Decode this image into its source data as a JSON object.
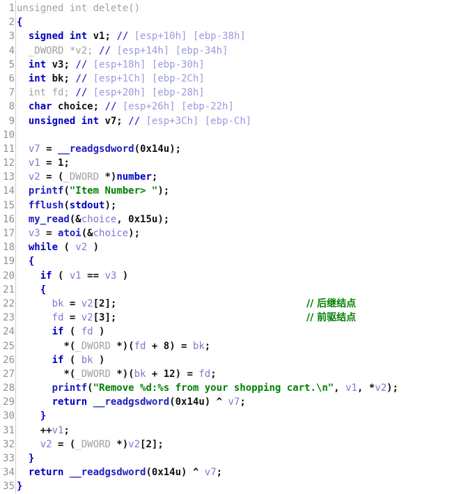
{
  "view": {
    "name": "hexrays-pseudocode",
    "function_name": "delete",
    "first_line": 1,
    "last_line": 35,
    "total_lines": 35
  },
  "colors": {
    "background": "#ffffff",
    "line_number": "#909090",
    "greyed_text": "#a0a0a0",
    "keyword": "#0000c0",
    "local_variable": "#7a7ad0",
    "global_variable": "#0000c0",
    "function_name": "#2020c0",
    "string_literal": "#008000",
    "comment": "#008000",
    "stack_comment": "#9a9ae0",
    "gutter_rule": "#d0d0d0"
  },
  "side_comments": [
    {
      "line": 22,
      "text": "// 后继结点"
    },
    {
      "line": 23,
      "text": "// 前驱结点"
    }
  ],
  "lines": [
    {
      "n": "1",
      "tokens": [
        {
          "t": "gray",
          "v": "unsigned int delete()"
        }
      ]
    },
    {
      "n": "2",
      "tokens": [
        {
          "t": "brace",
          "v": "{"
        }
      ]
    },
    {
      "n": "3",
      "tokens": [
        {
          "t": "plain",
          "v": "  "
        },
        {
          "t": "kw",
          "v": "signed int"
        },
        {
          "t": "plain",
          "v": " v1; "
        },
        {
          "t": "slash",
          "v": "// "
        },
        {
          "t": "stk",
          "v": "[esp+10h] [ebp-38h]"
        }
      ]
    },
    {
      "n": "4",
      "tokens": [
        {
          "t": "plain",
          "v": "  "
        },
        {
          "t": "gray",
          "v": "_DWORD *v2; "
        },
        {
          "t": "slash",
          "v": "// "
        },
        {
          "t": "stk",
          "v": "[esp+14h] [ebp-34h]"
        }
      ]
    },
    {
      "n": "5",
      "tokens": [
        {
          "t": "plain",
          "v": "  "
        },
        {
          "t": "kw",
          "v": "int"
        },
        {
          "t": "plain",
          "v": " v3; "
        },
        {
          "t": "slash",
          "v": "// "
        },
        {
          "t": "stk",
          "v": "[esp+18h] [ebp-30h]"
        }
      ]
    },
    {
      "n": "6",
      "tokens": [
        {
          "t": "plain",
          "v": "  "
        },
        {
          "t": "kw",
          "v": "int"
        },
        {
          "t": "plain",
          "v": " bk; "
        },
        {
          "t": "slash",
          "v": "// "
        },
        {
          "t": "stk",
          "v": "[esp+1Ch] [ebp-2Ch]"
        }
      ]
    },
    {
      "n": "7",
      "tokens": [
        {
          "t": "plain",
          "v": "  "
        },
        {
          "t": "gray",
          "v": "int fd; "
        },
        {
          "t": "slash",
          "v": "// "
        },
        {
          "t": "stk",
          "v": "[esp+20h] [ebp-28h]"
        }
      ]
    },
    {
      "n": "8",
      "tokens": [
        {
          "t": "plain",
          "v": "  "
        },
        {
          "t": "kw",
          "v": "char"
        },
        {
          "t": "plain",
          "v": " choice; "
        },
        {
          "t": "slash",
          "v": "// "
        },
        {
          "t": "stk",
          "v": "[esp+26h] [ebp-22h]"
        }
      ]
    },
    {
      "n": "9",
      "tokens": [
        {
          "t": "plain",
          "v": "  "
        },
        {
          "t": "kw",
          "v": "unsigned int"
        },
        {
          "t": "plain",
          "v": " v7; "
        },
        {
          "t": "slash",
          "v": "// "
        },
        {
          "t": "stk",
          "v": "[esp+3Ch] [ebp-Ch]"
        }
      ]
    },
    {
      "n": "10",
      "tokens": []
    },
    {
      "n": "11",
      "tokens": [
        {
          "t": "plain",
          "v": "  "
        },
        {
          "t": "var",
          "v": "v7"
        },
        {
          "t": "punct",
          "v": " = "
        },
        {
          "t": "fn",
          "v": "__readgsdword"
        },
        {
          "t": "punct",
          "v": "("
        },
        {
          "t": "num",
          "v": "0x14u"
        },
        {
          "t": "punct",
          "v": ");"
        }
      ]
    },
    {
      "n": "12",
      "tokens": [
        {
          "t": "plain",
          "v": "  "
        },
        {
          "t": "var",
          "v": "v1"
        },
        {
          "t": "punct",
          "v": " = "
        },
        {
          "t": "num",
          "v": "1"
        },
        {
          "t": "punct",
          "v": ";"
        }
      ]
    },
    {
      "n": "13",
      "tokens": [
        {
          "t": "plain",
          "v": "  "
        },
        {
          "t": "var",
          "v": "v2"
        },
        {
          "t": "punct",
          "v": " = ("
        },
        {
          "t": "gray",
          "v": "_DWORD"
        },
        {
          "t": "punct",
          "v": " *)"
        },
        {
          "t": "gvar",
          "v": "number"
        },
        {
          "t": "punct",
          "v": ";"
        }
      ]
    },
    {
      "n": "14",
      "tokens": [
        {
          "t": "plain",
          "v": "  "
        },
        {
          "t": "fn",
          "v": "printf"
        },
        {
          "t": "punct",
          "v": "("
        },
        {
          "t": "str",
          "v": "\"Item Number> \""
        },
        {
          "t": "punct",
          "v": ");"
        }
      ]
    },
    {
      "n": "15",
      "tokens": [
        {
          "t": "plain",
          "v": "  "
        },
        {
          "t": "fn",
          "v": "fflush"
        },
        {
          "t": "punct",
          "v": "("
        },
        {
          "t": "gvar",
          "v": "stdout"
        },
        {
          "t": "punct",
          "v": ");"
        }
      ]
    },
    {
      "n": "16",
      "tokens": [
        {
          "t": "plain",
          "v": "  "
        },
        {
          "t": "fn",
          "v": "my_read"
        },
        {
          "t": "punct",
          "v": "(&"
        },
        {
          "t": "var",
          "v": "choice"
        },
        {
          "t": "punct",
          "v": ", "
        },
        {
          "t": "num",
          "v": "0x15u"
        },
        {
          "t": "punct",
          "v": ");"
        }
      ]
    },
    {
      "n": "17",
      "tokens": [
        {
          "t": "plain",
          "v": "  "
        },
        {
          "t": "var",
          "v": "v3"
        },
        {
          "t": "punct",
          "v": " = "
        },
        {
          "t": "fn",
          "v": "atoi"
        },
        {
          "t": "punct",
          "v": "(&"
        },
        {
          "t": "var",
          "v": "choice"
        },
        {
          "t": "punct",
          "v": ");"
        }
      ]
    },
    {
      "n": "18",
      "tokens": [
        {
          "t": "plain",
          "v": "  "
        },
        {
          "t": "kw",
          "v": "while"
        },
        {
          "t": "punct",
          "v": " ( "
        },
        {
          "t": "var",
          "v": "v2"
        },
        {
          "t": "punct",
          "v": " )"
        }
      ]
    },
    {
      "n": "19",
      "tokens": [
        {
          "t": "plain",
          "v": "  "
        },
        {
          "t": "brace",
          "v": "{"
        }
      ]
    },
    {
      "n": "20",
      "tokens": [
        {
          "t": "plain",
          "v": "    "
        },
        {
          "t": "kw",
          "v": "if"
        },
        {
          "t": "punct",
          "v": " ( "
        },
        {
          "t": "var",
          "v": "v1"
        },
        {
          "t": "punct",
          "v": " == "
        },
        {
          "t": "var",
          "v": "v3"
        },
        {
          "t": "punct",
          "v": " )"
        }
      ]
    },
    {
      "n": "21",
      "tokens": [
        {
          "t": "plain",
          "v": "    "
        },
        {
          "t": "brace",
          "v": "{"
        }
      ]
    },
    {
      "n": "22",
      "tokens": [
        {
          "t": "plain",
          "v": "      "
        },
        {
          "t": "var",
          "v": "bk"
        },
        {
          "t": "punct",
          "v": " = "
        },
        {
          "t": "var",
          "v": "v2"
        },
        {
          "t": "punct",
          "v": "["
        },
        {
          "t": "num",
          "v": "2"
        },
        {
          "t": "punct",
          "v": "];"
        }
      ]
    },
    {
      "n": "23",
      "tokens": [
        {
          "t": "plain",
          "v": "      "
        },
        {
          "t": "var",
          "v": "fd"
        },
        {
          "t": "punct",
          "v": " = "
        },
        {
          "t": "var",
          "v": "v2"
        },
        {
          "t": "punct",
          "v": "["
        },
        {
          "t": "num",
          "v": "3"
        },
        {
          "t": "punct",
          "v": "];"
        }
      ]
    },
    {
      "n": "24",
      "tokens": [
        {
          "t": "plain",
          "v": "      "
        },
        {
          "t": "kw",
          "v": "if"
        },
        {
          "t": "punct",
          "v": " ( "
        },
        {
          "t": "var",
          "v": "fd"
        },
        {
          "t": "punct",
          "v": " )"
        }
      ]
    },
    {
      "n": "25",
      "tokens": [
        {
          "t": "plain",
          "v": "        "
        },
        {
          "t": "punct",
          "v": "*("
        },
        {
          "t": "gray",
          "v": "_DWORD"
        },
        {
          "t": "punct",
          "v": " *)("
        },
        {
          "t": "var",
          "v": "fd"
        },
        {
          "t": "punct",
          "v": " + "
        },
        {
          "t": "num",
          "v": "8"
        },
        {
          "t": "punct",
          "v": ") = "
        },
        {
          "t": "var",
          "v": "bk"
        },
        {
          "t": "punct",
          "v": ";"
        }
      ]
    },
    {
      "n": "26",
      "tokens": [
        {
          "t": "plain",
          "v": "      "
        },
        {
          "t": "kw",
          "v": "if"
        },
        {
          "t": "punct",
          "v": " ( "
        },
        {
          "t": "var",
          "v": "bk"
        },
        {
          "t": "punct",
          "v": " )"
        }
      ]
    },
    {
      "n": "27",
      "tokens": [
        {
          "t": "plain",
          "v": "        "
        },
        {
          "t": "punct",
          "v": "*("
        },
        {
          "t": "gray",
          "v": "_DWORD"
        },
        {
          "t": "punct",
          "v": " *)("
        },
        {
          "t": "var",
          "v": "bk"
        },
        {
          "t": "punct",
          "v": " + "
        },
        {
          "t": "num",
          "v": "12"
        },
        {
          "t": "punct",
          "v": ") = "
        },
        {
          "t": "var",
          "v": "fd"
        },
        {
          "t": "punct",
          "v": ";"
        }
      ]
    },
    {
      "n": "28",
      "tokens": [
        {
          "t": "plain",
          "v": "      "
        },
        {
          "t": "fn",
          "v": "printf"
        },
        {
          "t": "punct",
          "v": "("
        },
        {
          "t": "str",
          "v": "\"Remove %d:%s from your shopping cart.\\n\""
        },
        {
          "t": "punct",
          "v": ", "
        },
        {
          "t": "var",
          "v": "v1"
        },
        {
          "t": "punct",
          "v": ", *"
        },
        {
          "t": "var",
          "v": "v2"
        },
        {
          "t": "punct",
          "v": ");"
        }
      ]
    },
    {
      "n": "29",
      "tokens": [
        {
          "t": "plain",
          "v": "      "
        },
        {
          "t": "kw",
          "v": "return"
        },
        {
          "t": "punct",
          "v": " "
        },
        {
          "t": "fn",
          "v": "__readgsdword"
        },
        {
          "t": "punct",
          "v": "("
        },
        {
          "t": "num",
          "v": "0x14u"
        },
        {
          "t": "punct",
          "v": ") ^ "
        },
        {
          "t": "var",
          "v": "v7"
        },
        {
          "t": "punct",
          "v": ";"
        }
      ]
    },
    {
      "n": "30",
      "tokens": [
        {
          "t": "plain",
          "v": "    "
        },
        {
          "t": "brace",
          "v": "}"
        }
      ]
    },
    {
      "n": "31",
      "tokens": [
        {
          "t": "plain",
          "v": "    "
        },
        {
          "t": "punct",
          "v": "++"
        },
        {
          "t": "var",
          "v": "v1"
        },
        {
          "t": "punct",
          "v": ";"
        }
      ]
    },
    {
      "n": "32",
      "tokens": [
        {
          "t": "plain",
          "v": "    "
        },
        {
          "t": "var",
          "v": "v2"
        },
        {
          "t": "punct",
          "v": " = ("
        },
        {
          "t": "gray",
          "v": "_DWORD"
        },
        {
          "t": "punct",
          "v": " *)"
        },
        {
          "t": "var",
          "v": "v2"
        },
        {
          "t": "punct",
          "v": "["
        },
        {
          "t": "num",
          "v": "2"
        },
        {
          "t": "punct",
          "v": "];"
        }
      ]
    },
    {
      "n": "33",
      "tokens": [
        {
          "t": "plain",
          "v": "  "
        },
        {
          "t": "brace",
          "v": "}"
        }
      ]
    },
    {
      "n": "34",
      "tokens": [
        {
          "t": "plain",
          "v": "  "
        },
        {
          "t": "kw",
          "v": "return"
        },
        {
          "t": "punct",
          "v": " "
        },
        {
          "t": "fn",
          "v": "__readgsdword"
        },
        {
          "t": "punct",
          "v": "("
        },
        {
          "t": "num",
          "v": "0x14u"
        },
        {
          "t": "punct",
          "v": ") ^ "
        },
        {
          "t": "var",
          "v": "v7"
        },
        {
          "t": "punct",
          "v": ";"
        }
      ]
    },
    {
      "n": "35",
      "tokens": [
        {
          "t": "brace",
          "v": "}"
        }
      ]
    }
  ]
}
